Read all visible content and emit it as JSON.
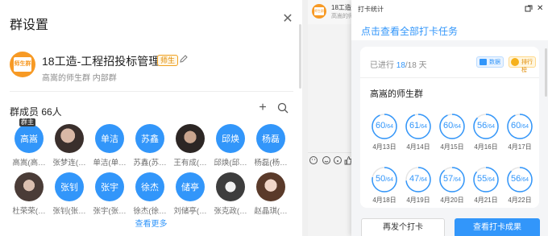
{
  "left_panel": {
    "title": "群设置",
    "close_icon": "close-icon",
    "group": {
      "avatar_text": "师生群",
      "name": "18工造-工程招投标管理",
      "tag": "师生",
      "subtitle": "高嵩的师生群 内部群"
    },
    "members_title": "群成员 66人",
    "owner_tag": "群主",
    "members_row1": [
      {
        "avatar": "高嵩",
        "name": "高嵩(高…",
        "photo": false
      },
      {
        "avatar": "",
        "name": "张梦连(…",
        "photo": true
      },
      {
        "avatar": "单洁",
        "name": "单洁(单…",
        "photo": false
      },
      {
        "avatar": "苏鑫",
        "name": "苏鑫(苏…",
        "photo": false
      },
      {
        "avatar": "",
        "name": "王有成(…",
        "photo": true
      },
      {
        "avatar": "邱焕",
        "name": "邱焕(邱…",
        "photo": false
      },
      {
        "avatar": "杨磊",
        "name": "杨磊(杨…",
        "photo": false
      }
    ],
    "members_row2": [
      {
        "avatar": "",
        "name": "杜荣荣(…",
        "photo": true
      },
      {
        "avatar": "张钊",
        "name": "张钊(张…",
        "photo": false
      },
      {
        "avatar": "张宇",
        "name": "张宇(张…",
        "photo": false
      },
      {
        "avatar": "徐杰",
        "name": "徐杰(徐…",
        "photo": false
      },
      {
        "avatar": "储亭",
        "name": "刘储亭(…",
        "photo": false
      },
      {
        "avatar": "",
        "name": "张克政(…",
        "photo": true
      },
      {
        "avatar": "",
        "name": "赵晶琪(…",
        "photo": true
      }
    ],
    "view_more": "查看更多"
  },
  "chat": {
    "avatar_text": "师生群",
    "title": "18工造…",
    "subtitle": "高嵩的师…"
  },
  "stats_panel": {
    "title": "打卡统计",
    "link": "点击查看全部打卡任务",
    "progress_prefix": "已进行 ",
    "progress_done": "18",
    "progress_suffix": "/18 天",
    "data_label": "数据",
    "rank_label": "排行榜",
    "group_name": "高嵩的师生群",
    "total": 64,
    "total_label": "/64",
    "days": [
      {
        "value": "60",
        "date": "4月13日"
      },
      {
        "value": "61",
        "date": "4月14日"
      },
      {
        "value": "60",
        "date": "4月15日"
      },
      {
        "value": "56",
        "date": "4月16日"
      },
      {
        "value": "60",
        "date": "4月17日"
      },
      {
        "value": "50",
        "date": "4月18日"
      },
      {
        "value": "47",
        "date": "4月19日"
      },
      {
        "value": "57",
        "date": "4月20日"
      },
      {
        "value": "55",
        "date": "4月21日"
      },
      {
        "value": "56",
        "date": "4月22日"
      }
    ],
    "resend_button": "再发个打卡",
    "view_button": "查看打卡成果"
  },
  "colors": {
    "accent": "#3296fa",
    "brand_orange": "#f79a25"
  }
}
